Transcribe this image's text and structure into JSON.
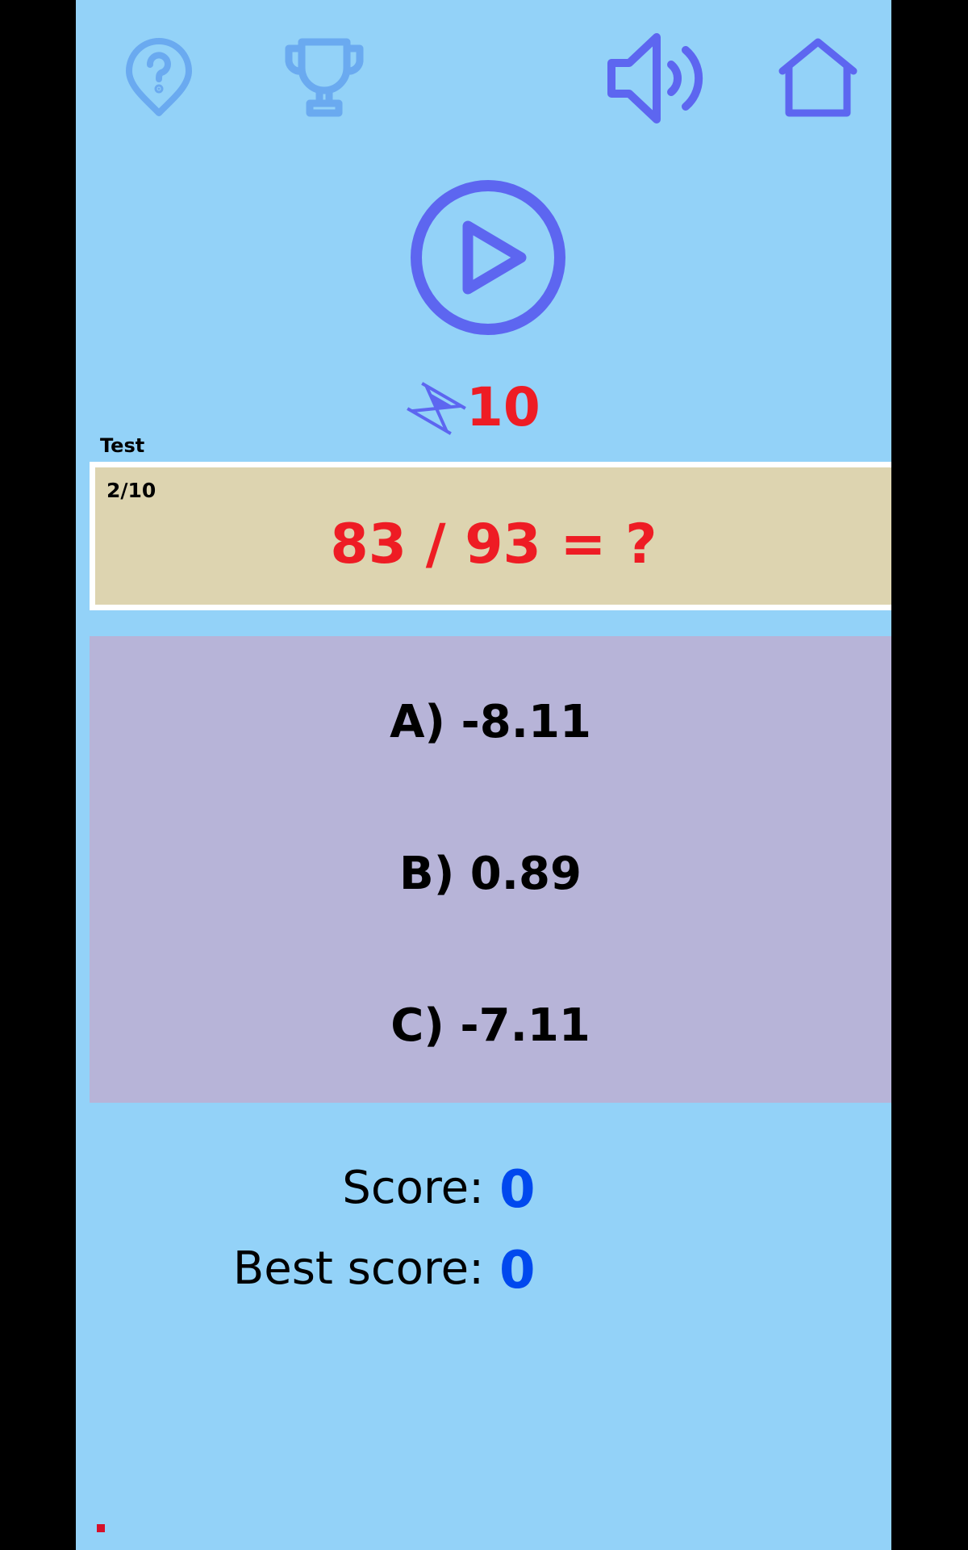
{
  "top_bar": {
    "icons": [
      "help-icon",
      "trophy-icon",
      "sound-icon",
      "home-icon"
    ],
    "colors": {
      "faded_icon": "#6aaaf0",
      "active_icon": "#5d66f0"
    }
  },
  "play_button": {
    "icon": "play-icon",
    "color": "#5d66f0"
  },
  "timer": {
    "icon": "hourglass-icon",
    "value": "10",
    "color": "#ee1c24"
  },
  "quiz": {
    "mode_label": "Test",
    "progress": "2/10",
    "question": "83 / 93 = ?",
    "question_color": "#ee1c24"
  },
  "answers": [
    {
      "text": "A) -8.11"
    },
    {
      "text": "B) 0.89"
    },
    {
      "text": "C) -7.11"
    }
  ],
  "scores": {
    "score_label": "Score:",
    "score_value": "0",
    "best_label": "Best score:",
    "best_value": "0",
    "value_color": "#0048ee"
  },
  "colors": {
    "background": "#93d2f8",
    "question_box": "#ddd4b0",
    "answers_panel": "#b7b4d8",
    "side_bars": "#000000"
  }
}
